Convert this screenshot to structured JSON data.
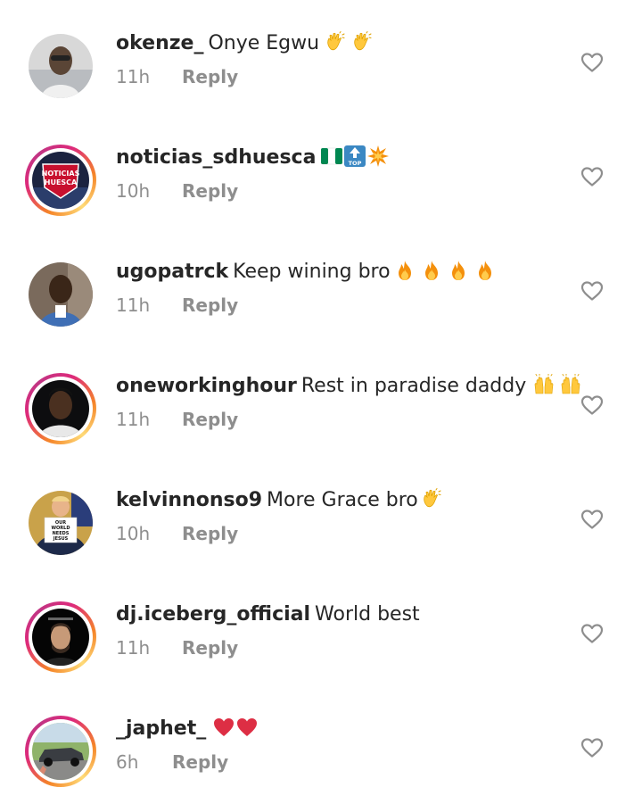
{
  "comments": [
    {
      "username": "okenze_",
      "text": "Onye Egwu",
      "time": "11h",
      "reply": "Reply",
      "emojis": [
        "clap-icon",
        "clap-icon"
      ]
    },
    {
      "username": "noticias_sdhuesca",
      "text": "",
      "time": "10h",
      "reply": "Reply",
      "emojis": [
        "nigeria-flag-icon",
        "top-arrow-icon",
        "collision-icon"
      ],
      "avatar_text": [
        "NOTICIAS",
        "HUESCA"
      ]
    },
    {
      "username": "ugopatrck",
      "text": "Keep wining bro",
      "time": "11h",
      "reply": "Reply",
      "emojis": [
        "fire-icon",
        "fire-icon",
        "fire-icon",
        "fire-icon"
      ]
    },
    {
      "username": "oneworkinghour",
      "text": "Rest in paradise daddy",
      "time": "11h",
      "reply": "Reply",
      "emojis": [
        "raising-hands-icon",
        "raising-hands-icon"
      ]
    },
    {
      "username": "kelvinnonso9",
      "text": "More Grace bro",
      "time": "10h",
      "reply": "Reply",
      "emojis": [
        "clap-icon"
      ],
      "avatar_text": [
        "OUR",
        "WORLD",
        "NEEDS",
        "JESUS"
      ]
    },
    {
      "username": "dj.iceberg_official",
      "text": "World best",
      "time": "11h",
      "reply": "Reply",
      "emojis": []
    },
    {
      "username": "_japhet_",
      "text": "",
      "time": "6h",
      "reply": "Reply",
      "emojis": [
        "red-heart-icon",
        "red-heart-icon"
      ]
    }
  ],
  "colors": {
    "primary_text": "#262626",
    "secondary_text": "#8e8e8e",
    "heart_outline": "#8e8e8e",
    "story_ring_start": "#f58529",
    "story_ring_end": "#dd2a7b"
  }
}
